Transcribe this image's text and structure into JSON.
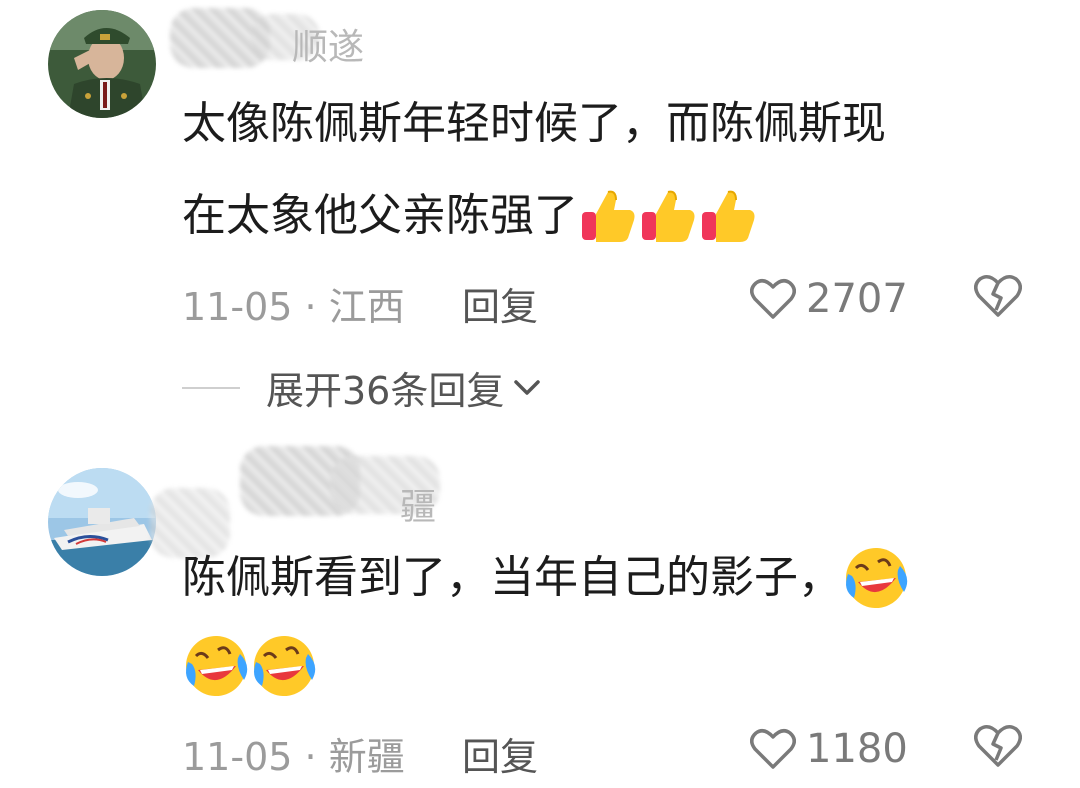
{
  "comments": [
    {
      "username_fragment": "顺遂",
      "text_line1": "太像陈佩斯年轻时候了，而陈佩斯现",
      "text_line2": "在太象他父亲陈强了",
      "emoji_icons": [
        "thumbs-up-icon",
        "thumbs-up-icon",
        "thumbs-up-icon"
      ],
      "date": "11-05",
      "location": "江西",
      "reply_label": "回复",
      "like_count": "2707",
      "expand_label": "展开36条回复"
    },
    {
      "username_fragment": "疆",
      "text_line1": "陈佩斯看到了，当年自己的影子，",
      "emoji_icons": [
        "laughing-crying-face-icon",
        "laughing-crying-face-icon",
        "laughing-crying-face-icon"
      ],
      "date": "11-05",
      "location": "新疆",
      "reply_label": "回复",
      "like_count": "1180"
    }
  ],
  "colors": {
    "text": "#1c1c1c",
    "meta": "#9b9b9b",
    "reply": "#555555",
    "icon": "#7a7a7a"
  }
}
